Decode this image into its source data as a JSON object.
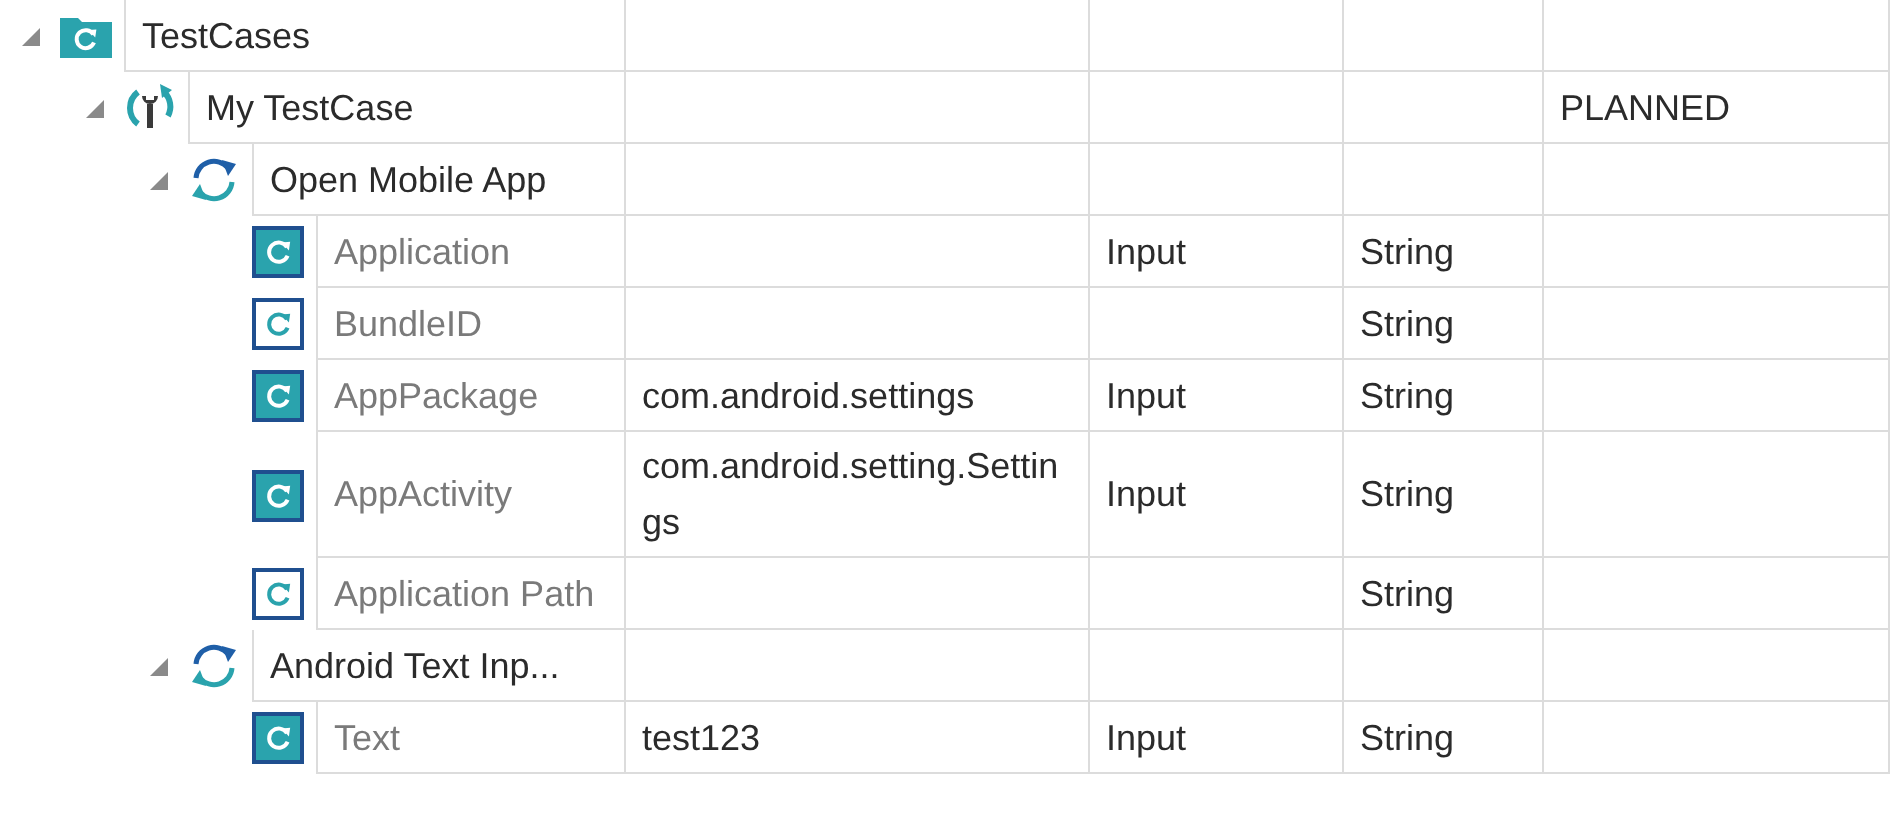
{
  "tree": [
    {
      "kind": "folder",
      "label": "TestCases",
      "expanded": true,
      "children": [
        {
          "kind": "testcase",
          "label": "My TestCase",
          "expanded": true,
          "column_5": "PLANNED",
          "children": [
            {
              "kind": "action",
              "label": "Open Mobile App",
              "expanded": true,
              "children": [
                {
                  "kind": "parameter",
                  "filled": true,
                  "label": "Application",
                  "column_3": "Input",
                  "column_4": "String"
                },
                {
                  "kind": "parameter",
                  "filled": false,
                  "label": "BundleID",
                  "column_4": "String"
                },
                {
                  "kind": "parameter",
                  "filled": true,
                  "label": "AppPackage",
                  "column_2": "com.android.settings",
                  "column_3": "Input",
                  "column_4": "String"
                },
                {
                  "kind": "parameter",
                  "filled": true,
                  "label": "AppActivity",
                  "column_2": "com.android.setting.Settings",
                  "column_3": "Input",
                  "column_4": "String"
                },
                {
                  "kind": "parameter",
                  "filled": false,
                  "label": "Application Path",
                  "column_4": "String"
                }
              ]
            },
            {
              "kind": "action",
              "label": "Android Text Inp...",
              "expanded": true,
              "children": [
                {
                  "kind": "parameter",
                  "filled": true,
                  "label": "Text",
                  "column_2": "test123",
                  "column_3": "Input",
                  "column_4": "String"
                }
              ]
            }
          ]
        }
      ]
    }
  ]
}
